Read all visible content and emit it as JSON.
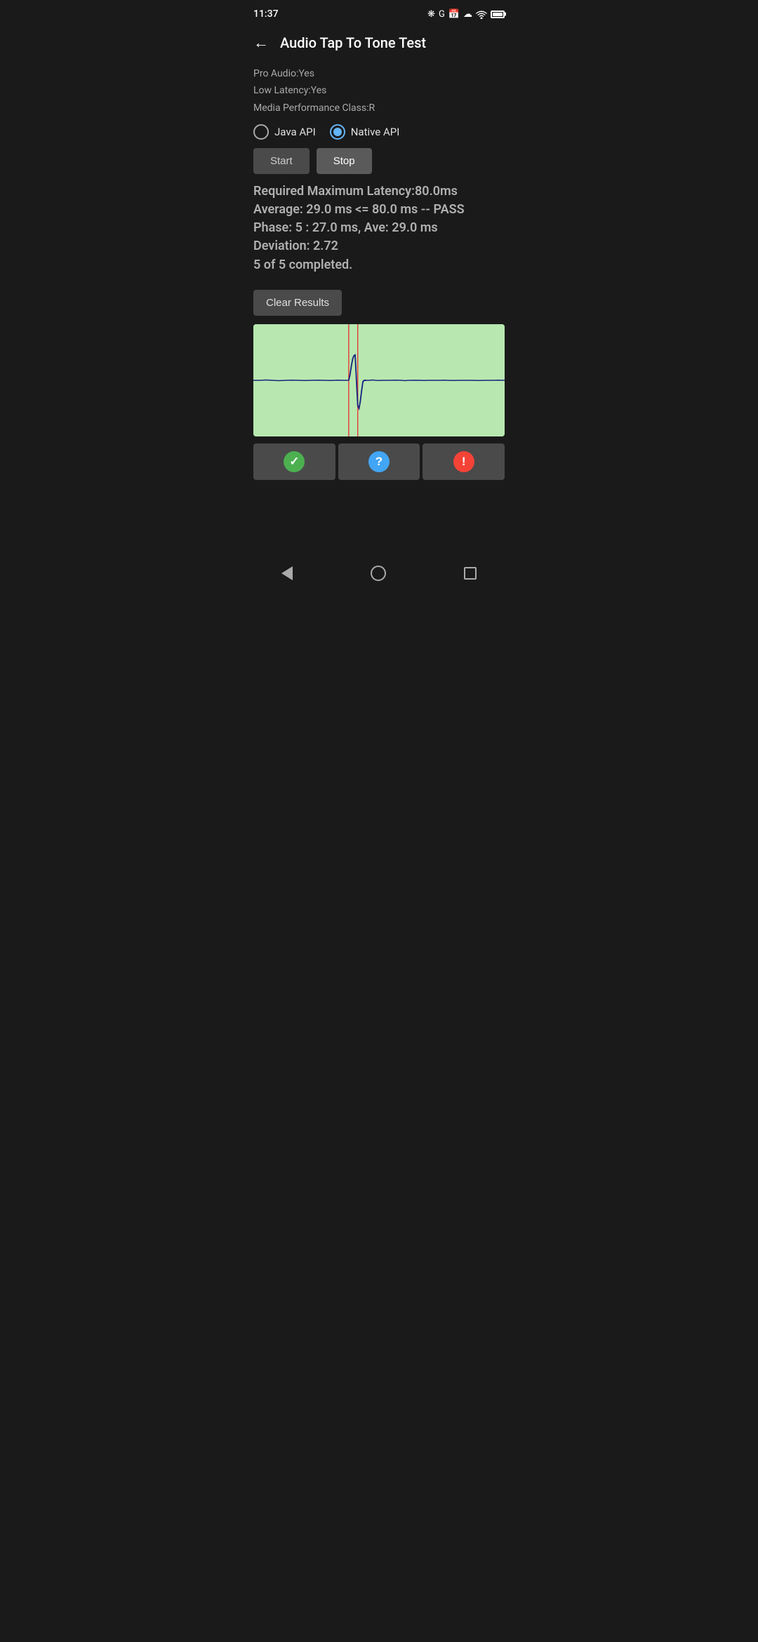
{
  "statusBar": {
    "time": "11:37"
  },
  "appBar": {
    "title": "Audio Tap To Tone Test",
    "backLabel": "←"
  },
  "deviceInfo": {
    "proAudio": "Pro Audio:Yes",
    "lowLatency": "Low Latency:Yes",
    "mediaPerformance": "Media Performance Class:R"
  },
  "radioGroup": {
    "options": [
      {
        "label": "Java API",
        "selected": false
      },
      {
        "label": "Native API",
        "selected": true
      }
    ]
  },
  "buttons": {
    "start": "Start",
    "stop": "Stop",
    "clearResults": "Clear Results"
  },
  "results": {
    "line1": "Required Maximum Latency:80.0ms",
    "line2": "Average: 29.0 ms <= 80.0 ms -- PASS",
    "line3": "Phase: 5 : 27.0 ms, Ave: 29.0 ms",
    "line4": "Deviation: 2.72",
    "line5": "5 of 5 completed."
  },
  "actionButtons": {
    "check": "✓",
    "question": "?",
    "exclaim": "!"
  },
  "nav": {
    "back": "back",
    "home": "home",
    "recents": "recents"
  }
}
